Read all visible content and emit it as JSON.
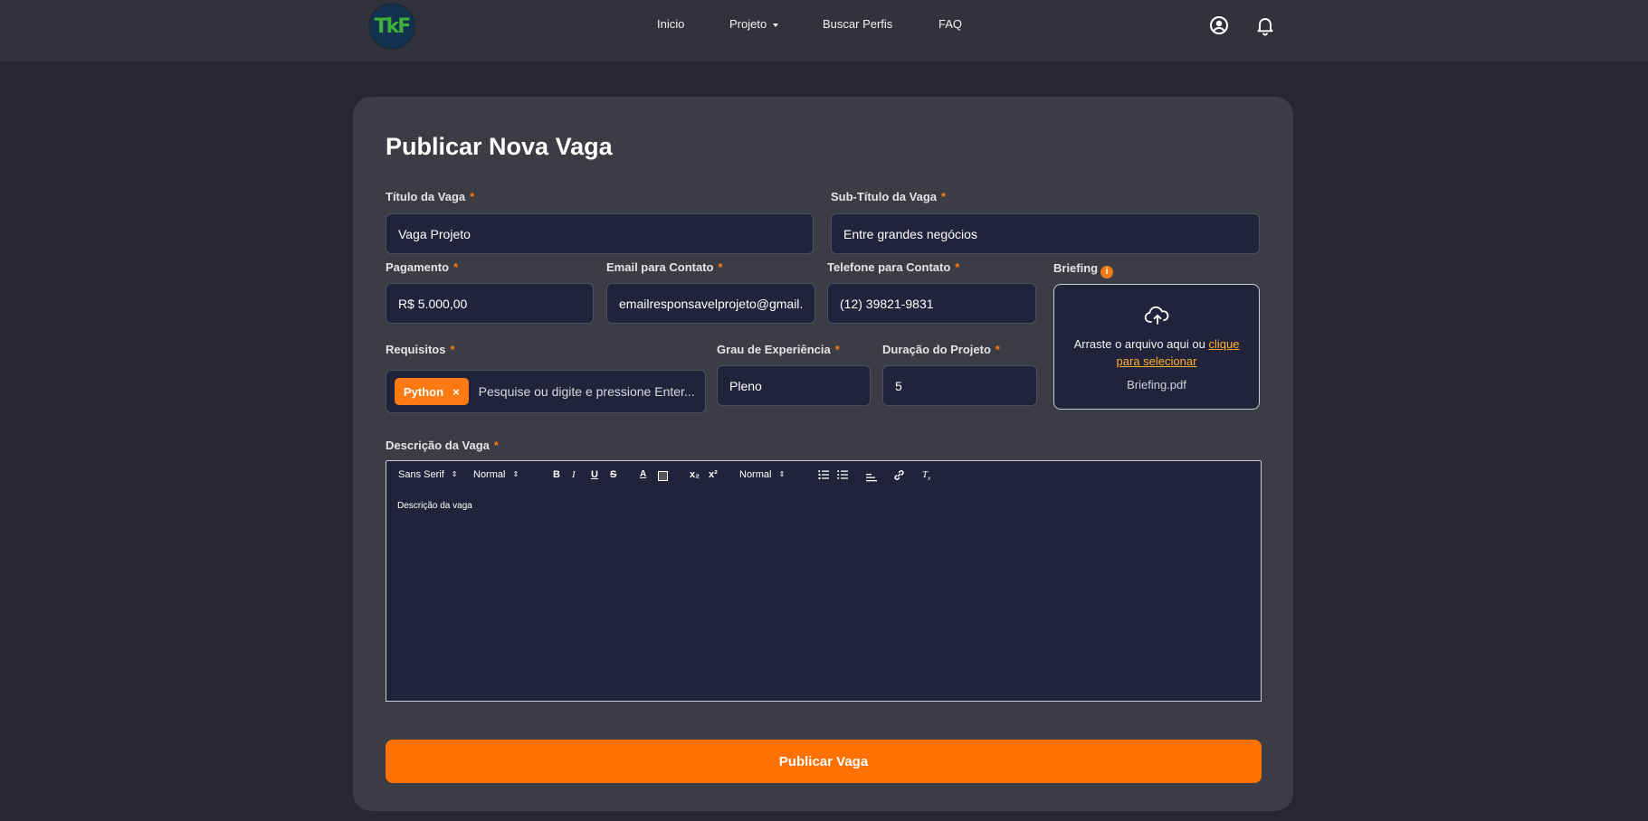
{
  "app": {
    "logo_text": "TkF"
  },
  "nav": {
    "items": [
      {
        "label": "Inicio"
      },
      {
        "label": "Projeto"
      },
      {
        "label": "Buscar Perfis"
      },
      {
        "label": "FAQ"
      }
    ],
    "icons": [
      "user-circle-icon",
      "bell-icon"
    ]
  },
  "form": {
    "title": "Publicar Nova Vaga",
    "required_mark": "*",
    "titulo": {
      "label": "Título da Vaga",
      "value": "Vaga Projeto"
    },
    "subtitulo": {
      "label": "Sub-Título da Vaga",
      "value": "Entre grandes negócios"
    },
    "pagamento": {
      "label": "Pagamento",
      "value": "R$ 5.000,00"
    },
    "email": {
      "label": "Email para Contato",
      "value": "emailresponsavelprojeto@gmail.com"
    },
    "telefone": {
      "label": "Telefone para Contato",
      "value": "(12) 39821-9831"
    },
    "briefing": {
      "label": "Briefing",
      "info": "i",
      "drop_text": "Arraste o arquivo aqui ou",
      "link_part1": "clique",
      "link_part2": "para selecionar",
      "file_name": "Briefing.pdf"
    },
    "requisitos": {
      "label": "Requisitos",
      "tags": [
        "Python"
      ],
      "tag_remove": "×",
      "placeholder": "Pesquise ou digite e pressione Enter..."
    },
    "experiencia": {
      "label": "Grau de Experiência",
      "value": "Pleno"
    },
    "duracao": {
      "label": "Duração do Projeto",
      "value": "5"
    },
    "descricao": {
      "label": "Descrição da Vaga",
      "toolbar": {
        "font": "Sans Serif",
        "size": "Normal",
        "header": "Normal"
      },
      "content": "Descrição da vaga"
    },
    "submit_label": "Publicar Vaga"
  },
  "colors": {
    "accent": "#ff7102",
    "link": "#ffb02e",
    "background": "#27272f",
    "card": "#3c3d44",
    "input": "#22233a"
  }
}
